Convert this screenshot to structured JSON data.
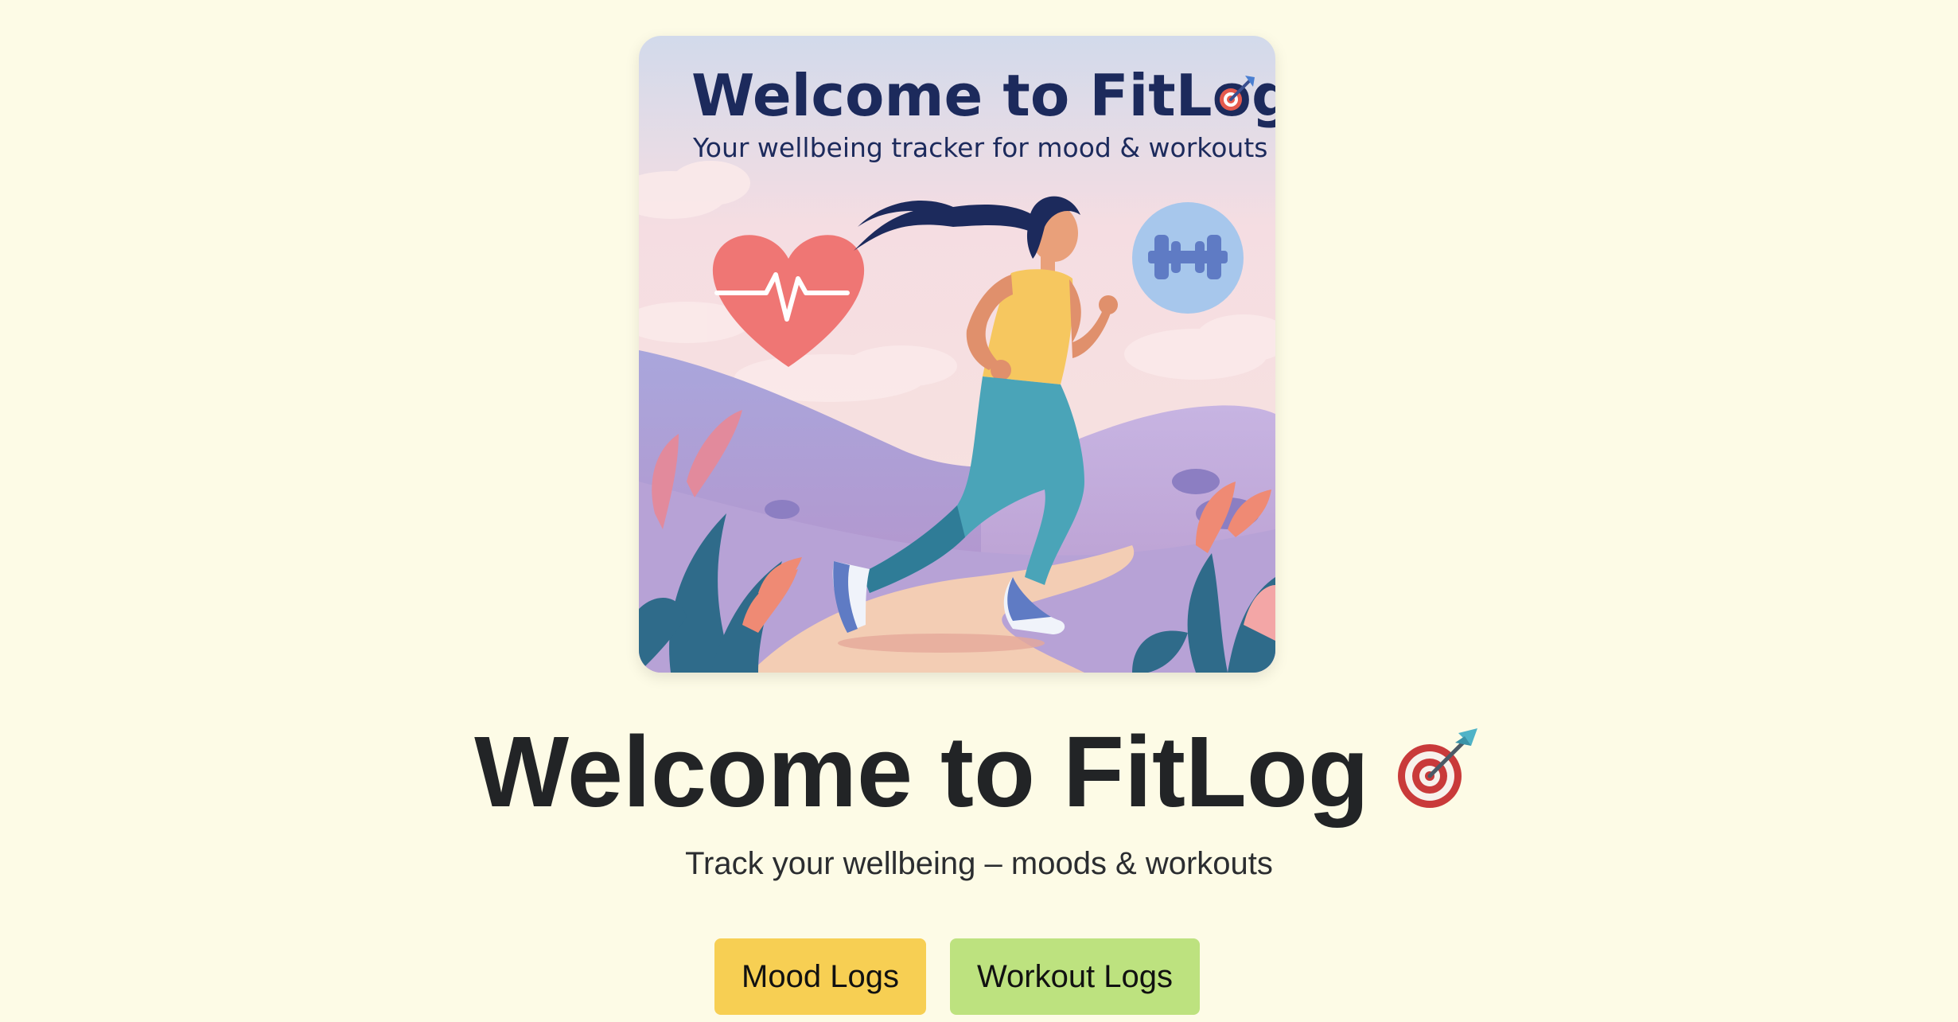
{
  "hero_image": {
    "title": "Welcome to FitLog",
    "subtitle": "Your wellbeing tracker for mood & workouts"
  },
  "headline": {
    "title": "Welcome to FitLog",
    "emoji": "dart-target-icon"
  },
  "tagline": "Track your wellbeing – moods & workouts",
  "buttons": {
    "mood_label": "Mood Logs",
    "workout_label": "Workout Logs"
  },
  "colors": {
    "background": "#fdfbe6",
    "mood_button": "#f7cf53",
    "workout_button": "#bde27f",
    "heading_text": "#222426"
  }
}
